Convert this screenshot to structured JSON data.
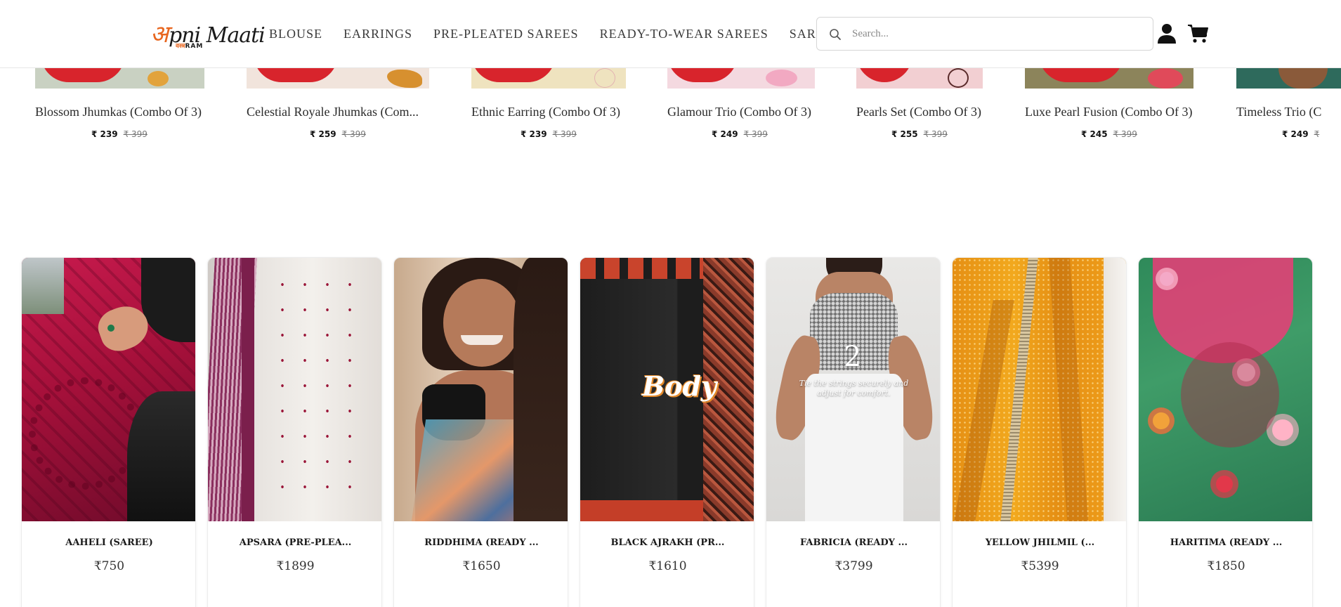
{
  "header": {
    "logo": {
      "initial": "अ",
      "rest": "pni Maati",
      "sub_a": "वस्त्र",
      "sub_b": "RAM"
    },
    "nav": [
      "BLOUSE",
      "EARRINGS",
      "PRE-PLEATED SAREES",
      "READY-TO-WEAR SAREES",
      "SAREES"
    ],
    "search": {
      "placeholder": "Search..."
    },
    "icons": {
      "search": "search-icon",
      "user": "user-icon",
      "cart": "cart-icon"
    }
  },
  "earrings": [
    {
      "title": "Blossom Jhumkas (Combo Of 3)",
      "price": "₹ 239",
      "old_price": "₹ 399"
    },
    {
      "title": "Celestial Royale Jhumkas (Com...",
      "price": "₹ 259",
      "old_price": "₹ 399"
    },
    {
      "title": "Ethnic Earring (Combo Of 3)",
      "price": "₹ 239",
      "old_price": "₹ 399"
    },
    {
      "title": "Glamour Trio (Combo Of 3)",
      "price": "₹ 249",
      "old_price": "₹ 399"
    },
    {
      "title": "Pearls Set (Combo Of 3)",
      "price": "₹ 255",
      "old_price": "₹ 399"
    },
    {
      "title": "Luxe Pearl Fusion (Combo Of 3)",
      "price": "₹ 245",
      "old_price": "₹ 399"
    },
    {
      "title": "Timeless Trio (C",
      "price": "₹ 249",
      "old_price": "₹"
    }
  ],
  "products": [
    {
      "title": "AAHELI (SAREE)",
      "price": "₹750"
    },
    {
      "title": "APSARA (PRE-PLEA...",
      "price": "₹1899"
    },
    {
      "title": "RIDDHIMA (READY ...",
      "price": "₹1650"
    },
    {
      "title": "BLACK AJRAKH (PR...",
      "price": "₹1610",
      "overlay": "Body"
    },
    {
      "title": "FABRICIA (READY ...",
      "price": "₹3799",
      "overlay_number": "2",
      "overlay_caption_1": "Tie the strings securely and",
      "overlay_caption_2": "adjust for comfort."
    },
    {
      "title": "YELLOW JHILMIL (...",
      "price": "₹5399"
    },
    {
      "title": "HARITIMA (READY ...",
      "price": "₹1850"
    }
  ],
  "colors": {
    "accent": "#e8661f",
    "text": "#222222",
    "border": "#e6e6e6"
  }
}
